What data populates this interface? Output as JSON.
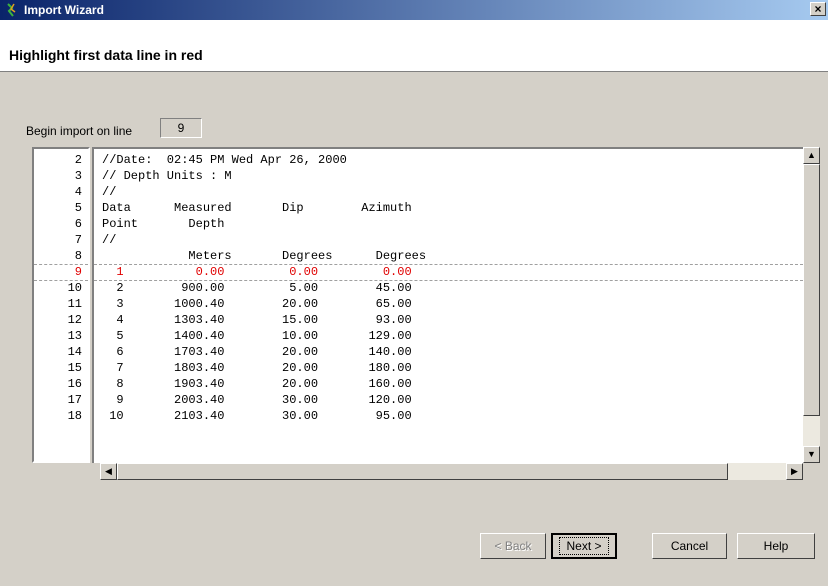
{
  "window": {
    "title": "Import Wizard",
    "close_glyph": "×"
  },
  "header": {
    "title": "Highlight first data line in red"
  },
  "begin_import": {
    "label": "Begin import on line",
    "value": "9"
  },
  "highlighted_line": "9",
  "rows": [
    {
      "num": "2",
      "text": "//Date:  02:45 PM Wed Apr 26, 2000"
    },
    {
      "num": "3",
      "text": "// Depth Units : M"
    },
    {
      "num": "4",
      "text": "//"
    },
    {
      "num": "5",
      "text": "Data      Measured       Dip        Azimuth"
    },
    {
      "num": "6",
      "text": "Point       Depth"
    },
    {
      "num": "7",
      "text": "//"
    },
    {
      "num": "8",
      "text": "            Meters       Degrees      Degrees"
    },
    {
      "num": "9",
      "text": "  1          0.00         0.00         0.00"
    },
    {
      "num": "10",
      "text": "  2        900.00         5.00        45.00"
    },
    {
      "num": "11",
      "text": "  3       1000.40        20.00        65.00"
    },
    {
      "num": "12",
      "text": "  4       1303.40        15.00        93.00"
    },
    {
      "num": "13",
      "text": "  5       1400.40        10.00       129.00"
    },
    {
      "num": "14",
      "text": "  6       1703.40        20.00       140.00"
    },
    {
      "num": "15",
      "text": "  7       1803.40        20.00       180.00"
    },
    {
      "num": "16",
      "text": "  8       1903.40        20.00       160.00"
    },
    {
      "num": "17",
      "text": "  9       2003.40        30.00       120.00"
    },
    {
      "num": "18",
      "text": " 10       2103.40        30.00        95.00"
    }
  ],
  "buttons": {
    "back": "< Back",
    "next": "Next >",
    "cancel": "Cancel",
    "help": "Help"
  },
  "colors": {
    "highlight": "#e00000",
    "title_start": "#0a246a",
    "title_end": "#a6caf0"
  }
}
